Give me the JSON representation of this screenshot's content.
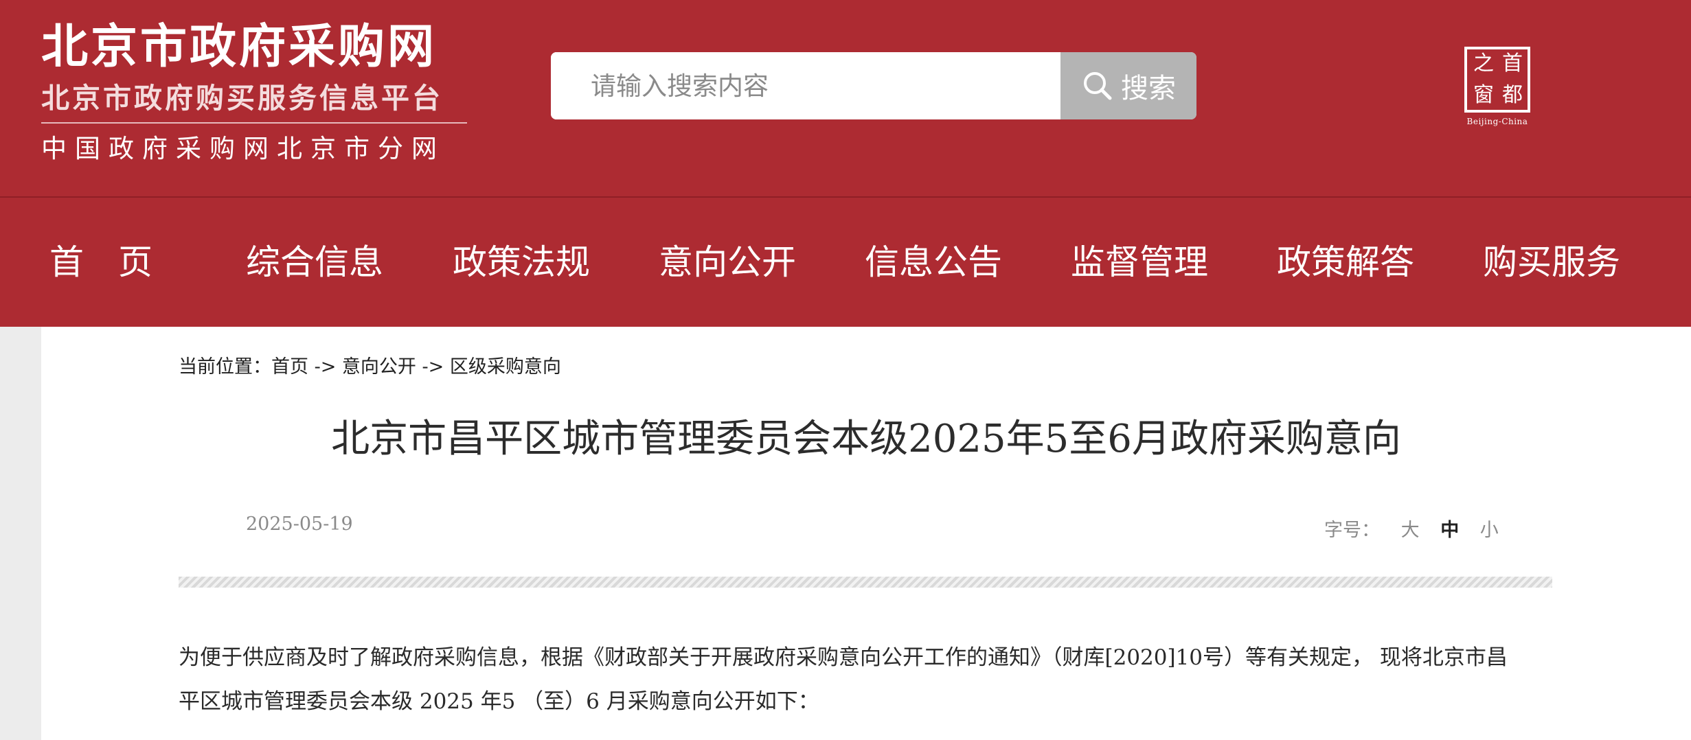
{
  "header": {
    "logo_main": "北京市政府采购网",
    "logo_sub": "北京市政府购买服务信息平台",
    "logo_sub2": "中国政府采购网北京市分网",
    "search": {
      "placeholder": "请输入搜索内容",
      "button_label": "搜索",
      "button_icon": "search-icon"
    },
    "emblem": {
      "chars": [
        "之",
        "首",
        "窗",
        "都"
      ],
      "caption": "Beijing-China"
    }
  },
  "nav": {
    "items": [
      {
        "label": "首　页"
      },
      {
        "label": "综合信息"
      },
      {
        "label": "政策法规"
      },
      {
        "label": "意向公开"
      },
      {
        "label": "信息公告"
      },
      {
        "label": "监督管理"
      },
      {
        "label": "政策解答"
      },
      {
        "label": "购买服务"
      }
    ]
  },
  "breadcrumb": {
    "prefix": "当前位置：",
    "items": [
      "首页",
      "意向公开",
      "区级采购意向"
    ],
    "separator": " -> "
  },
  "article": {
    "title": "北京市昌平区城市管理委员会本级2025年5至6月政府采购意向",
    "date": "2025-05-19",
    "font_size_label": "字号：",
    "font_size_options": [
      "大",
      "中",
      "小"
    ],
    "font_size_selected": "中",
    "body_lines": [
      "为便于供应商及时了解政府采购信息，根据《财政部关于开展政府采购意向公开工作的通知》（财库[2020]10号）等有关规定， 现将北京市昌",
      "平区城市管理委员会本级 2025 年5 （至）6 月采购意向公开如下："
    ]
  },
  "colors": {
    "brand_red": "#ad2b32",
    "search_button": "#b4b4b4",
    "page_background": "#ececec"
  }
}
